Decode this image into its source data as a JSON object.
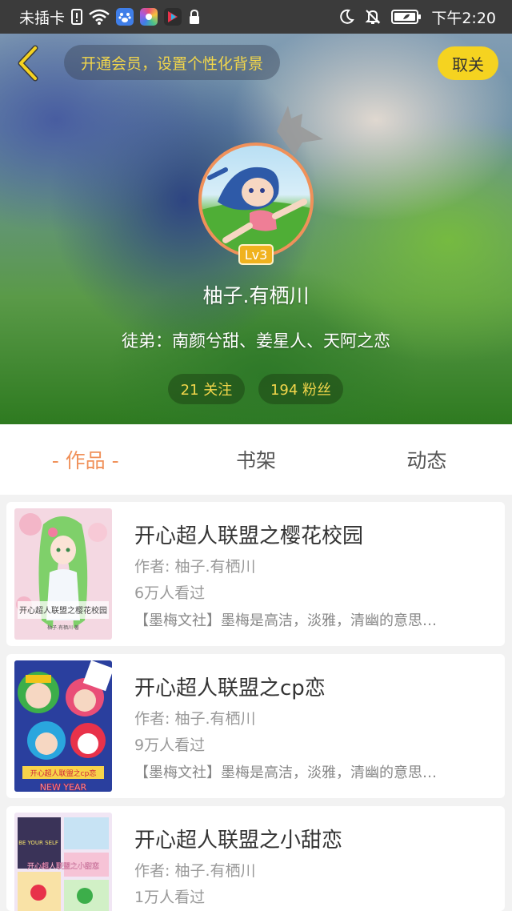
{
  "status_bar": {
    "carrier": "未插卡",
    "time": "下午2:20"
  },
  "header": {
    "vip_prompt": "开通会员，设置个性化背景",
    "cancel_label": "取关",
    "level": "Lv3",
    "username": "柚子.有栖川",
    "disciples": "徒弟：南颜兮甜、姜星人、天阿之恋",
    "following": "21 关注",
    "fans": "194 粉丝"
  },
  "tabs": [
    {
      "label": "- 作品 -",
      "active": true
    },
    {
      "label": "书架",
      "active": false
    },
    {
      "label": "动态",
      "active": false
    }
  ],
  "works": [
    {
      "title": "开心超人联盟之樱花校园",
      "author": "作者: 柚子.有栖川",
      "views": "6万人看过",
      "description": "【墨梅文社】墨梅是高洁，淡雅，清幽的意思…",
      "cover_text": "开心超人联盟之樱花校园",
      "cover_subtext": "柚子.有栖川 著"
    },
    {
      "title": "开心超人联盟之cp恋",
      "author": "作者: 柚子.有栖川",
      "views": "9万人看过",
      "description": "【墨梅文社】墨梅是高洁，淡雅，清幽的意思…",
      "cover_text": "开心超人联盟之cp恋",
      "cover_subtext": "NEW YEAR"
    },
    {
      "title": "开心超人联盟之小甜恋",
      "author": "作者: 柚子.有栖川",
      "views": "1万人看过",
      "description": "",
      "cover_text": "开心超人联盟之小甜恋",
      "cover_subtext": "BE YOUR SELF"
    }
  ]
}
